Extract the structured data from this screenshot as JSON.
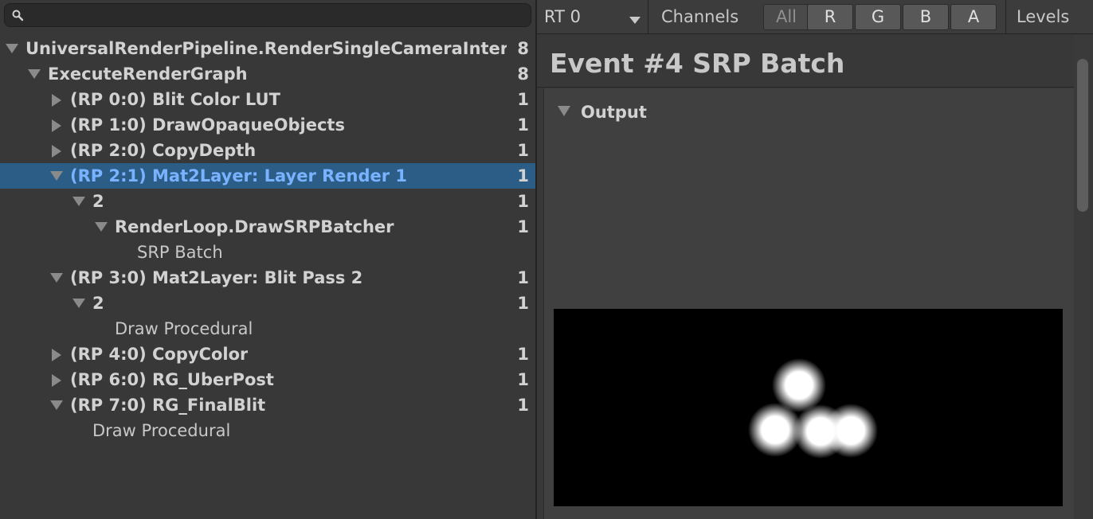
{
  "search": {
    "placeholder": "",
    "value": "",
    "icon": "search-icon"
  },
  "tree": [
    {
      "label": "UniversalRenderPipeline.RenderSingleCameraInternal",
      "count": "8",
      "depth": 0,
      "expand": "open",
      "bold": true
    },
    {
      "label": "ExecuteRenderGraph",
      "count": "8",
      "depth": 1,
      "expand": "open",
      "bold": true
    },
    {
      "label": "(RP 0:0) Blit Color LUT",
      "count": "1",
      "depth": 2,
      "expand": "closed",
      "bold": true
    },
    {
      "label": "(RP 1:0) DrawOpaqueObjects",
      "count": "1",
      "depth": 2,
      "expand": "closed",
      "bold": true
    },
    {
      "label": "(RP 2:0) CopyDepth",
      "count": "1",
      "depth": 2,
      "expand": "closed",
      "bold": true
    },
    {
      "label": "(RP 2:1) Mat2Layer: Layer Render 1",
      "count": "1",
      "depth": 2,
      "expand": "open",
      "bold": true,
      "selected": true
    },
    {
      "label": "2",
      "count": "1",
      "depth": 3,
      "expand": "open",
      "bold": true
    },
    {
      "label": "RenderLoop.DrawSRPBatcher",
      "count": "1",
      "depth": 4,
      "expand": "open",
      "bold": true
    },
    {
      "label": "SRP Batch",
      "count": "",
      "depth": 5,
      "expand": "none",
      "bold": false
    },
    {
      "label": "(RP 3:0) Mat2Layer: Blit Pass 2",
      "count": "1",
      "depth": 2,
      "expand": "open",
      "bold": true
    },
    {
      "label": "2",
      "count": "1",
      "depth": 3,
      "expand": "open",
      "bold": true
    },
    {
      "label": "Draw Procedural",
      "count": "",
      "depth": 4,
      "expand": "none",
      "bold": false
    },
    {
      "label": "(RP 4:0) CopyColor",
      "count": "1",
      "depth": 2,
      "expand": "closed",
      "bold": true
    },
    {
      "label": "(RP 6:0) RG_UberPost",
      "count": "1",
      "depth": 2,
      "expand": "closed",
      "bold": true
    },
    {
      "label": "(RP 7:0) RG_FinalBlit",
      "count": "1",
      "depth": 2,
      "expand": "open",
      "bold": true
    },
    {
      "label": "Draw Procedural",
      "count": "",
      "depth": 3,
      "expand": "none",
      "bold": false
    }
  ],
  "toolbar": {
    "rt_value": "RT 0",
    "channels_label": "Channels",
    "channel_buttons": [
      "All",
      "R",
      "G",
      "B",
      "A"
    ],
    "levels_label": "Levels"
  },
  "event": {
    "title": "Event #4 SRP Batch"
  },
  "output": {
    "label": "Output"
  },
  "colors": {
    "selection": "#2c5d87",
    "selected_text": "#79b3ff",
    "background": "#383838"
  }
}
